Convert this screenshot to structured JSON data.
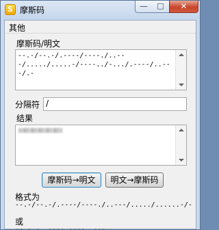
{
  "window": {
    "title": "摩斯码",
    "app_icon_glyph": "S"
  },
  "title_buttons": {
    "minimize_glyph": "—",
    "maximize_glyph": "□",
    "close_glyph": "✕"
  },
  "menu": {
    "items": [
      "其他"
    ]
  },
  "morse_section": {
    "label": "摩斯码/明文",
    "value": "--.-/--.-/.----/----./..---/...../.....-/----../-.../.----/..---/.-"
  },
  "separator": {
    "label": "分隔符",
    "value": "/"
  },
  "result": {
    "label": "结果",
    "value": ""
  },
  "buttons": {
    "morse_to_text": "摩斯码→明文",
    "text_to_morse": "明文→摩斯码"
  },
  "format": {
    "label": "格式为",
    "example1": "--.-/--.-/.----/----./..---/...../......-/-",
    "or_label": "或",
    "example2": "--.-.-..----.----..---"
  },
  "colors": {
    "titlebar": "#c9d9ec",
    "close_button": "#c7452b",
    "client_bg": "#f0f0f0"
  }
}
